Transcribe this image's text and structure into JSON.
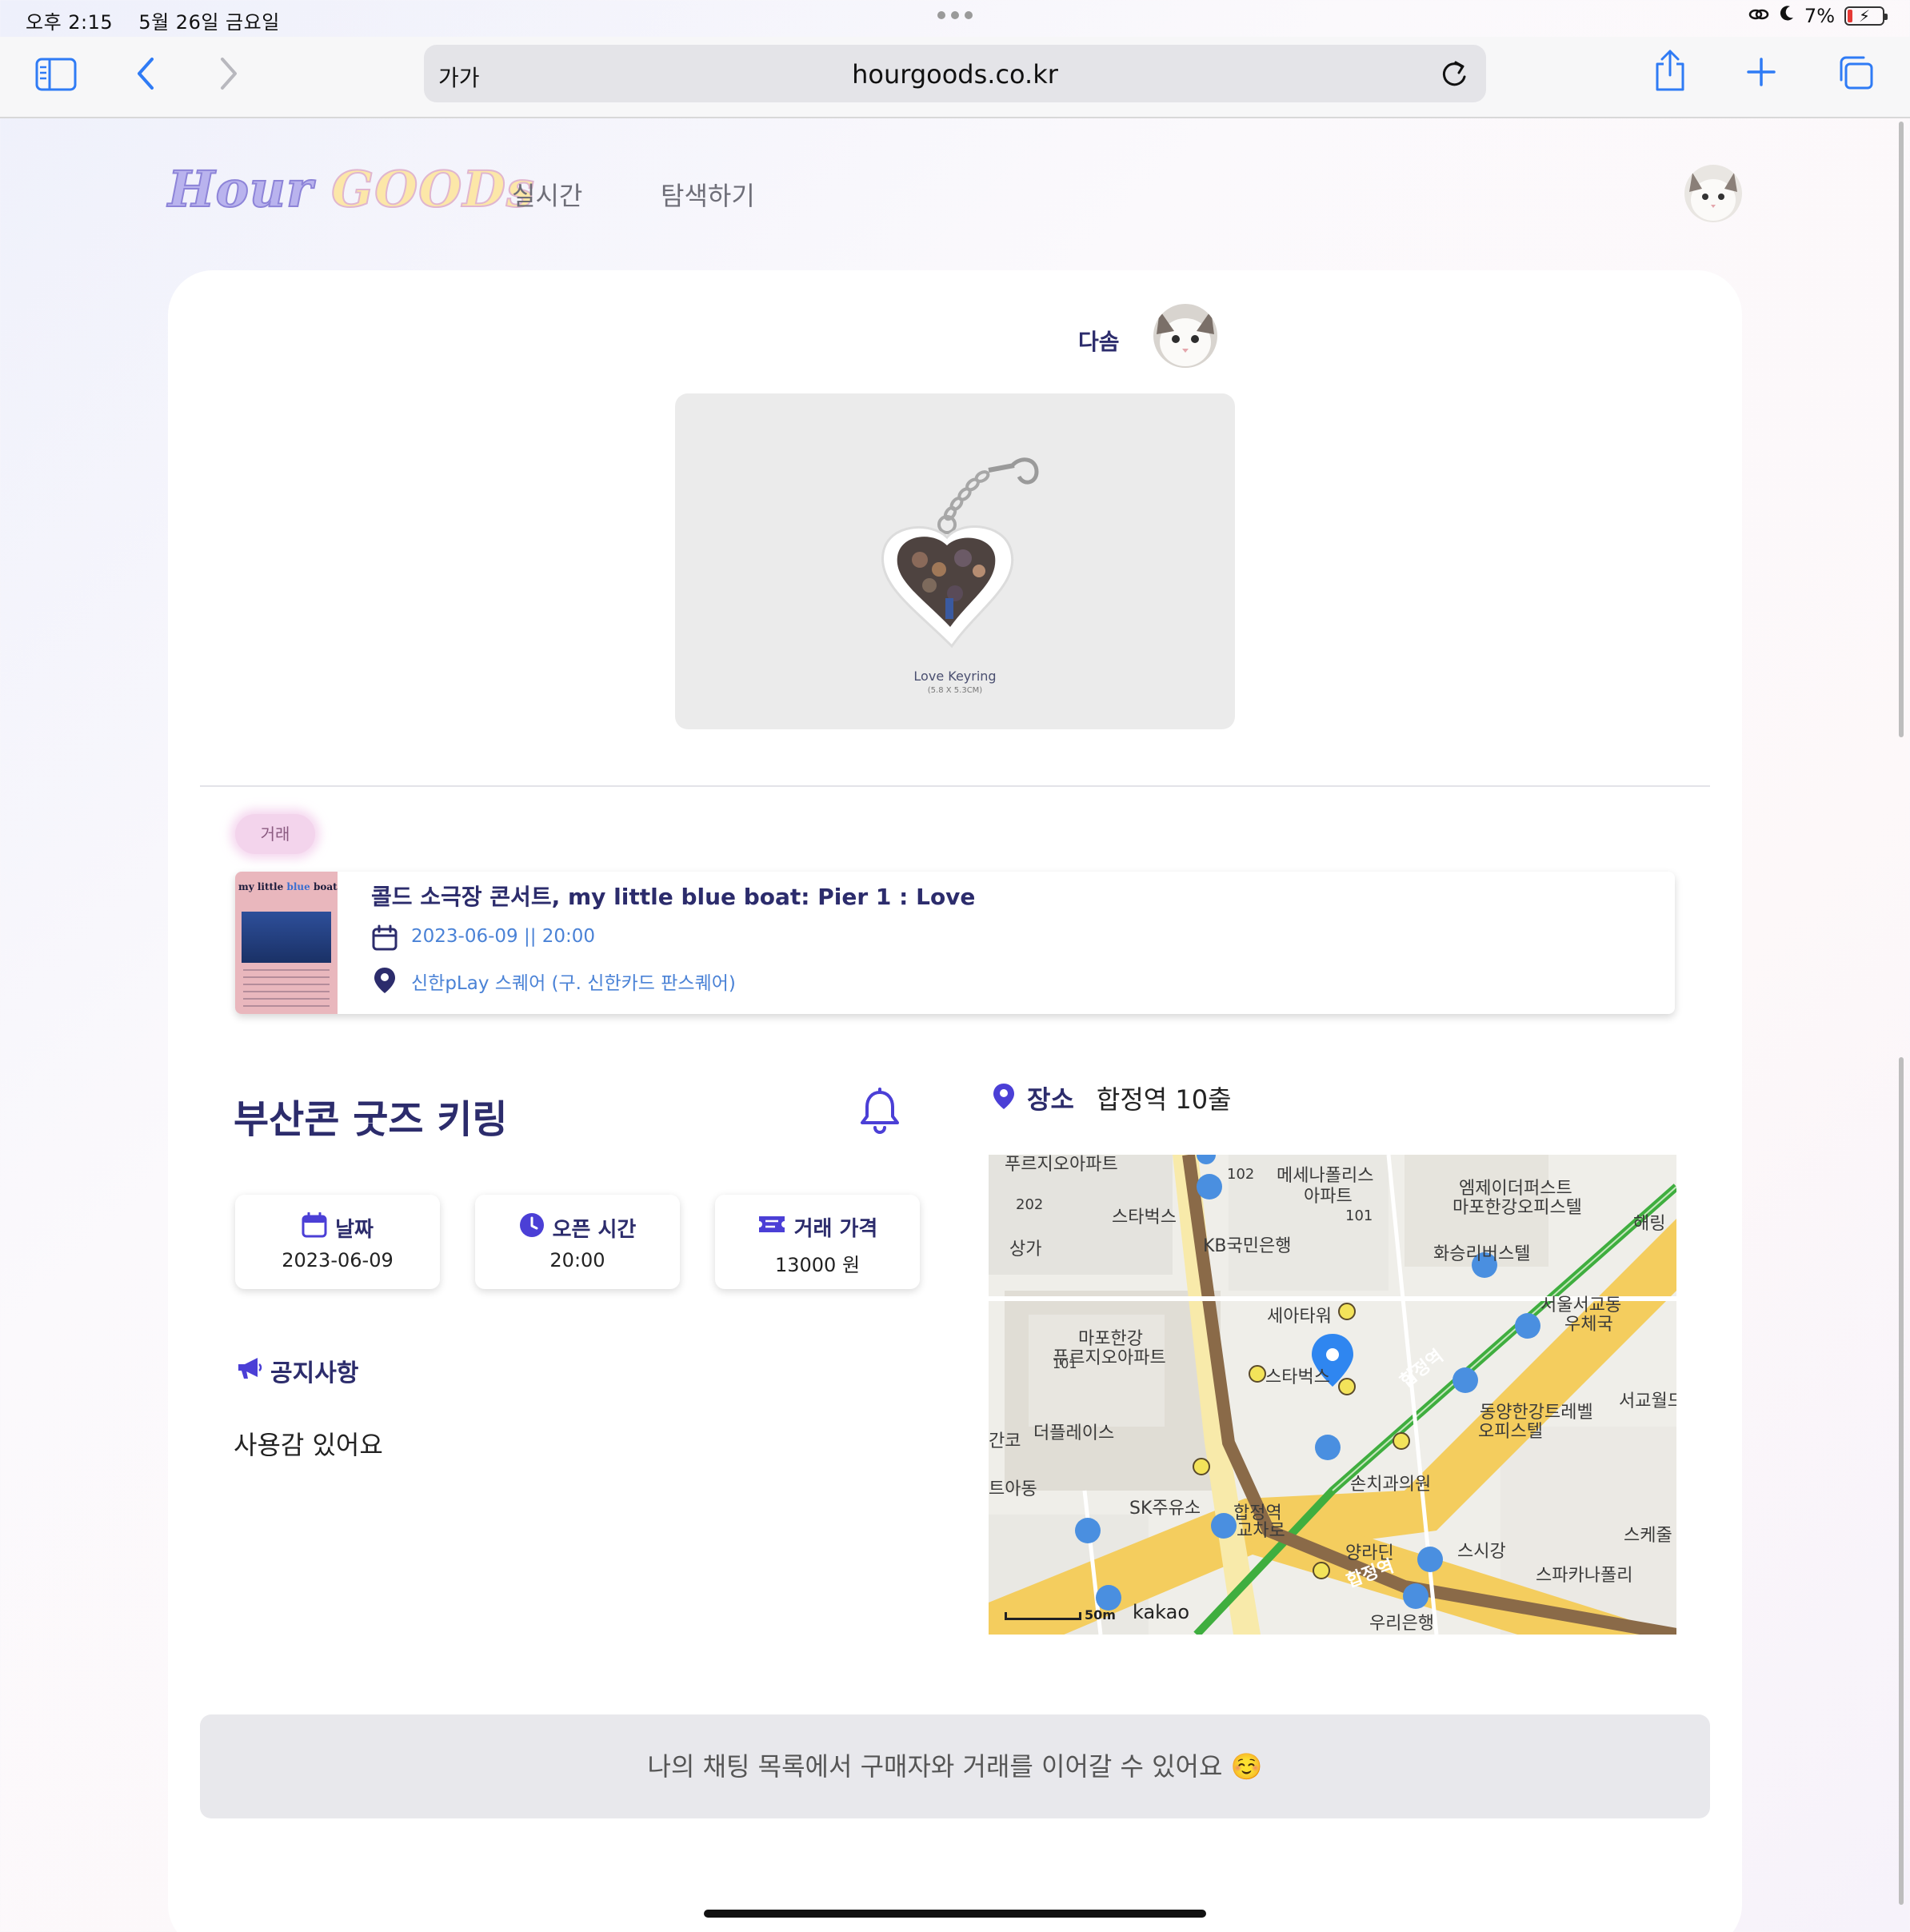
{
  "status_bar": {
    "time": "오후 2:15",
    "date": "5월 26일 금요일",
    "battery": "7%"
  },
  "browser": {
    "text_size_label": "가가",
    "url": "hourgoods.co.kr"
  },
  "header": {
    "logo_part1": "Hour",
    "logo_part2": "GOODs",
    "nav": [
      "실시간",
      "탐색하기"
    ]
  },
  "seller": {
    "name": "다솜"
  },
  "product_image": {
    "caption": "Love Keyring",
    "size_text": "(5.8 X 5.3CM)"
  },
  "tag": "거래",
  "event": {
    "poster_text": "my little",
    "poster_text_blue": "blue",
    "poster_text_end": "boat",
    "title": "콜드 소극장 콘서트, my little blue boat: Pier 1 : Love",
    "date": "2023-06-09 || 20:00",
    "place": "신한pLay 스퀘어 (구. 신한카드 판스퀘어)"
  },
  "post": {
    "title": "부산콘 굿즈 키링",
    "info": [
      {
        "label": "날짜",
        "value": "2023-06-09",
        "icon": "calendar-icon"
      },
      {
        "label": "오픈 시간",
        "value": "20:00",
        "icon": "clock-icon"
      },
      {
        "label": "거래 가격",
        "value": "13000 원",
        "icon": "ticket-icon"
      }
    ],
    "notice_label": "공지사항",
    "notice_body": "사용감 있어요",
    "place_label": "장소",
    "place_value": "합정역 10출"
  },
  "map": {
    "labels": [
      "푸르지오아파트",
      "102",
      "메세나폴리스",
      "아파트",
      "엠제이더퍼스트",
      "마포한강오피스텔",
      "202",
      "스타벅스",
      "101",
      "상가",
      "KB국민은행",
      "화승리버스텔",
      "해링",
      "세아타워",
      "서울서교동",
      "우체국",
      "마포한강",
      "푸르지오아파트",
      "101",
      "스타벅스",
      "합정역",
      "동양한강트레벨",
      "오피스텔",
      "서교월드",
      "간코",
      "더플레이스",
      "손치과의원",
      "트아동",
      "SK주유소",
      "합정역",
      "교차로",
      "스시강",
      "스케줄",
      "스파카나폴리",
      "양라딘",
      "합정역",
      "우리은행"
    ],
    "scale": "50m",
    "brand": "kakao"
  },
  "banner": "나의 채팅 목록에서 구매자와 거래를 이어갈 수 있어요 ☺️",
  "colors": {
    "accent": "#2c2c6c",
    "link": "#4a82d6",
    "brand_purple": "#4b3fd6"
  }
}
